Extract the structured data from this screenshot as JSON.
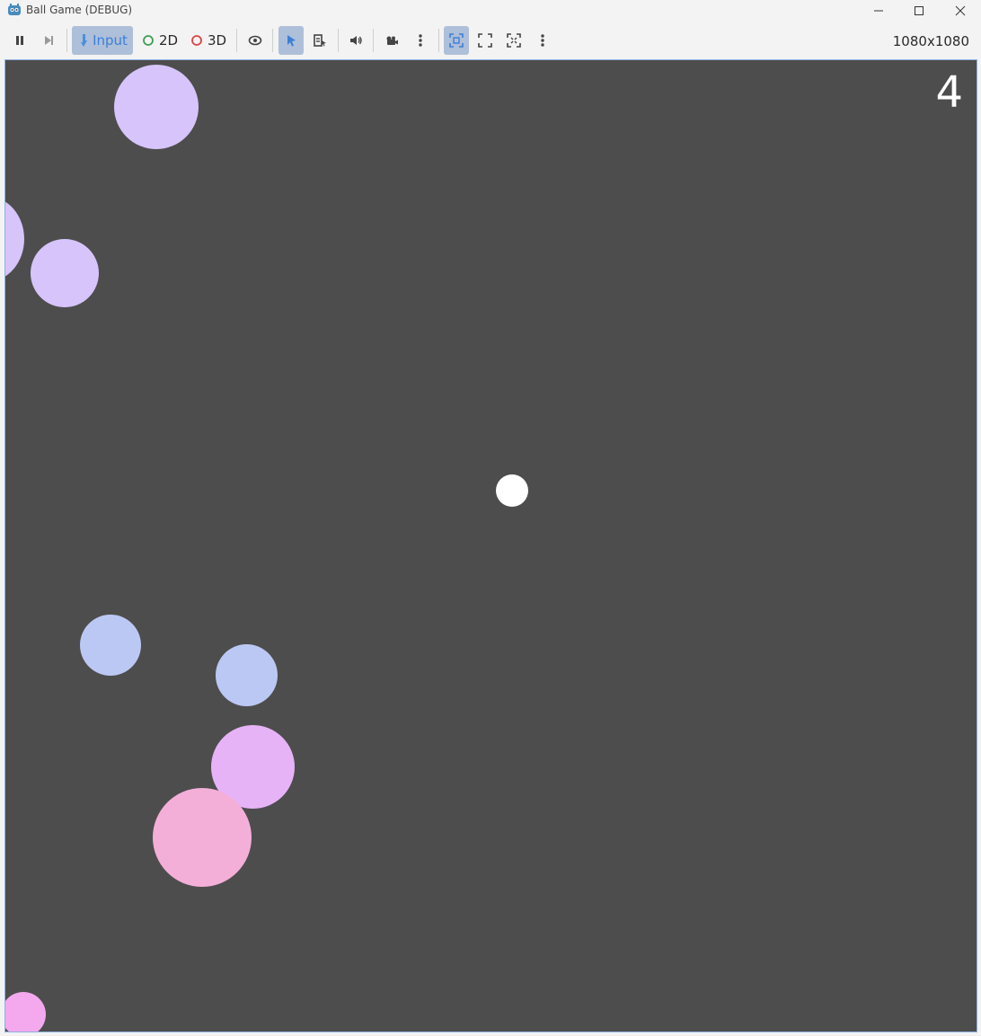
{
  "window": {
    "title": "Ball Game (DEBUG)",
    "icon": "godot-icon",
    "controls": [
      "minimize-icon",
      "maximize-icon",
      "close-icon"
    ]
  },
  "toolbar": {
    "input_label": "Input",
    "mode_2d_label": "2D",
    "mode_3d_label": "3D",
    "resolution": "1080x1080",
    "accent_color": "#aebfd9",
    "icons": [
      "pause-icon",
      "step-frame-icon",
      "input-icon",
      "2d-icon",
      "3d-icon",
      "visibility-icon",
      "select-cursor-icon",
      "list-select-icon",
      "audio-icon",
      "camera-icon",
      "more-options-icon",
      "fit-viewport-icon",
      "stretch-icon",
      "fullscreen-icon",
      "more-options-icon"
    ]
  },
  "game": {
    "score": "4",
    "background_color": "#4d4d4d",
    "balls_colors": [
      "#d6c4fb",
      "#d6c4fb",
      "#d6c4fb",
      "#ffffff",
      "#bcc8f4",
      "#bcc8f4",
      "#e7b3f7",
      "#f4afd9",
      "#f4a9ee"
    ]
  }
}
